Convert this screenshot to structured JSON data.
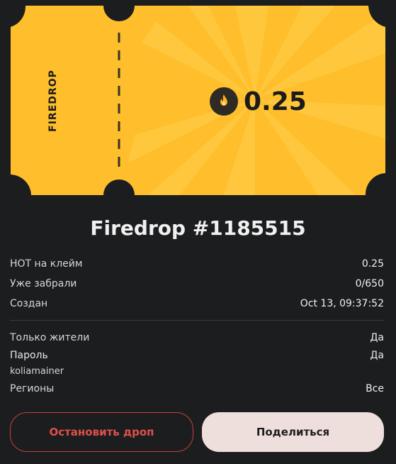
{
  "ticket": {
    "stub_label": "FIREDROP",
    "amount": "0.25",
    "color": "#ffbe2b",
    "icon": "flame-icon"
  },
  "title": "Firedrop #1185515",
  "details": {
    "hot_per_claim": {
      "label": "HOT на клейм",
      "value": "0.25"
    },
    "claimed": {
      "label": "Уже забрали",
      "value": "0/650"
    },
    "created": {
      "label": "Создан",
      "value": "Oct 13, 09:37:52"
    },
    "residents_only": {
      "label": "Только жители",
      "value": "Да"
    },
    "password": {
      "label": "Пароль",
      "value": "Да",
      "text": "koliamainer"
    },
    "regions": {
      "label": "Регионы",
      "value": "Все"
    }
  },
  "buttons": {
    "stop": "Остановить дроп",
    "share": "Поделиться"
  },
  "colors": {
    "background": "#1c1d1f",
    "stop_accent": "#e2504b",
    "share_bg": "#efdfdc"
  }
}
